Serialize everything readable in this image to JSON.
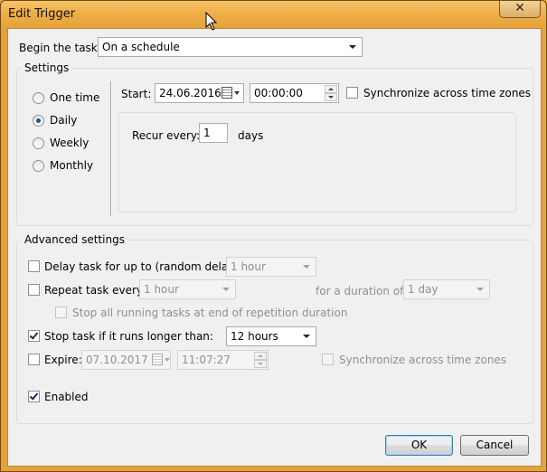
{
  "window": {
    "title": "Edit Trigger",
    "close_glyph": "✕"
  },
  "begin_task": {
    "label": "Begin the task:",
    "value": "On a schedule"
  },
  "settings": {
    "title": "Settings",
    "radios": [
      {
        "label": "One time",
        "checked": false
      },
      {
        "label": "Daily",
        "checked": true
      },
      {
        "label": "Weekly",
        "checked": false
      },
      {
        "label": "Monthly",
        "checked": false
      }
    ],
    "start_label": "Start:",
    "start_date": "24.06.2016",
    "start_time": "00:00:00",
    "sync_label": "Synchronize across time zones",
    "recur_label": "Recur every:",
    "recur_value": "1",
    "recur_unit": "days"
  },
  "advanced": {
    "title": "Advanced settings",
    "delay_label": "Delay task for up to (random delay):",
    "delay_value": "1 hour",
    "repeat_label": "Repeat task every:",
    "repeat_value": "1 hour",
    "duration_label": "for a duration of:",
    "duration_value": "1 day",
    "stop_running_label": "Stop all running tasks at end of repetition duration",
    "stop_if_label": "Stop task if it runs longer than:",
    "stop_if_value": "12 hours",
    "expire_label": "Expire:",
    "expire_date": "07.10.2017",
    "expire_time": "11:07:27",
    "expire_sync_label": "Synchronize across time zones",
    "enabled_label": "Enabled"
  },
  "buttons": {
    "ok": "OK",
    "cancel": "Cancel"
  },
  "icons": {
    "close": "close-icon",
    "calendar": "calendar-icon",
    "cursor": "mouse-cursor-icon"
  }
}
